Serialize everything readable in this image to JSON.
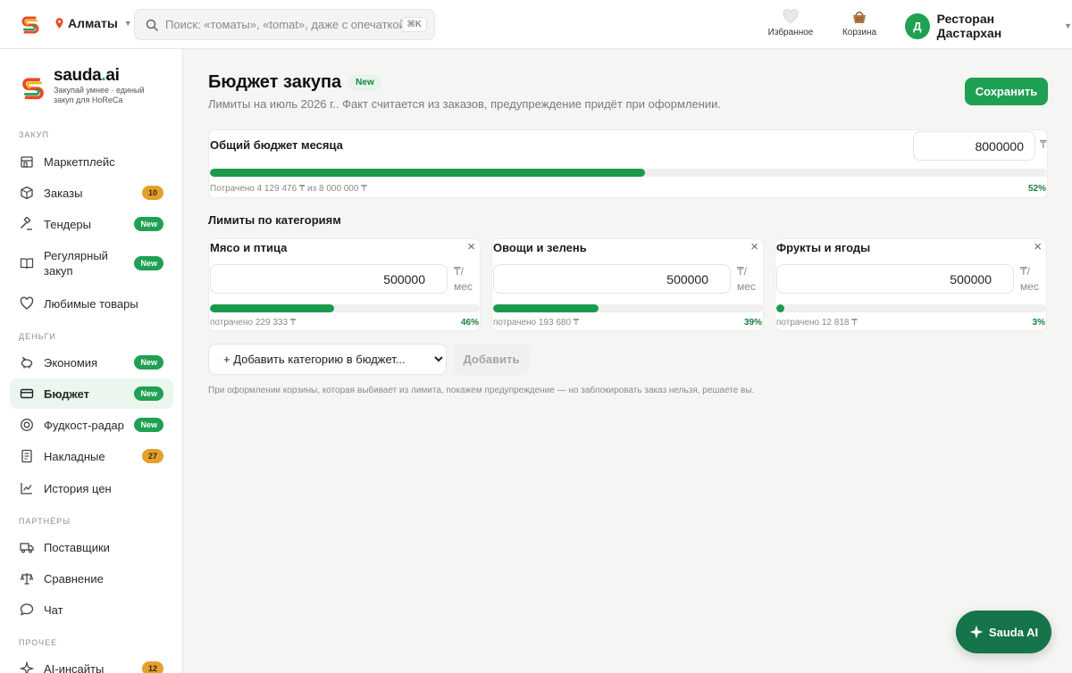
{
  "topbar": {
    "city": "Алматы",
    "search_placeholder": "Поиск: «томаты», «tomat», даже с опечаткой…",
    "search_shortcut": "⌘K",
    "favorites_label": "Избранное",
    "cart_label": "Корзина",
    "user_initial": "Д",
    "user_name": "Ресторан Дастархан"
  },
  "brand": {
    "name_main": "sauda",
    "name_dot": ".",
    "name_ai": "ai",
    "tagline": "Закупай умнее · единый закуп для HoReCa"
  },
  "sidebar": {
    "sections": [
      "ЗАКУП",
      "ДЕНЬГИ",
      "ПАРТНЁРЫ",
      "ПРОЧЕЕ"
    ],
    "items": [
      {
        "label": "Маркетплейс",
        "icon": "store-icon"
      },
      {
        "label": "Заказы",
        "icon": "box-icon",
        "badge": "10"
      },
      {
        "label": "Тендеры",
        "icon": "gavel-icon",
        "badge": "New"
      },
      {
        "label": "Регулярный закуп",
        "icon": "book-icon",
        "badge": "New"
      },
      {
        "label": "Любимые товары",
        "icon": "heart-icon"
      },
      {
        "label": "Экономия",
        "icon": "piggy-bank-icon",
        "badge": "New"
      },
      {
        "label": "Бюджет",
        "icon": "credit-card-icon",
        "badge": "New",
        "active": true
      },
      {
        "label": "Фудкост-радар",
        "icon": "radar-icon",
        "badge": "New"
      },
      {
        "label": "Накладные",
        "icon": "receipt-icon",
        "badge": "27"
      },
      {
        "label": "История цен",
        "icon": "line-chart-icon"
      },
      {
        "label": "Поставщики",
        "icon": "truck-icon"
      },
      {
        "label": "Сравнение",
        "icon": "scale-icon"
      },
      {
        "label": "Чат",
        "icon": "chat-icon"
      },
      {
        "label": "AI-инсайты",
        "icon": "sparkle-icon",
        "badge": "12"
      }
    ]
  },
  "page": {
    "title": "Бюджет закупа",
    "title_badge": "New",
    "subtitle": "Лимиты на июль 2026 г.. Факт считается из заказов, предупреждение придёт при оформлении.",
    "save_label": "Сохранить"
  },
  "total_budget": {
    "label": "Общий бюджет месяца",
    "value": "8000000",
    "currency": "₸",
    "spent_text": "Потрачено 4 129 476 ₸ из 8 000 000 ₸",
    "percent_text": "52%",
    "percent": 52
  },
  "categories_title": "Лимиты по категориям",
  "categories": [
    {
      "name": "Мясо и птица",
      "value": "500000",
      "unit_top": "₸/",
      "unit_bottom": "мес",
      "spent_text": "потрачено 229 333 ₸",
      "percent_text": "46%",
      "percent": 46
    },
    {
      "name": "Овощи и зелень",
      "value": "500000",
      "unit_top": "₸/",
      "unit_bottom": "мес",
      "spent_text": "потрачено 193 680 ₸",
      "percent_text": "39%",
      "percent": 39
    },
    {
      "name": "Фрукты и ягоды",
      "value": "500000",
      "unit_top": "₸/",
      "unit_bottom": "мес",
      "spent_text": "потрачено 12 818 ₸",
      "percent_text": "3%",
      "percent": 3
    }
  ],
  "add_category": {
    "select_label": "+ Добавить категорию в бюджет...",
    "button_label": "Добавить"
  },
  "note": "При оформлении корзины, которая выбивает из лимита, покажем предупреждение — но заблокировать заказ нельзя, решаете вы.",
  "ai_button": "Sauda AI",
  "colors": {
    "accent": "#1fa052",
    "badge_count": "#e3a12b",
    "fab": "#15744a"
  }
}
